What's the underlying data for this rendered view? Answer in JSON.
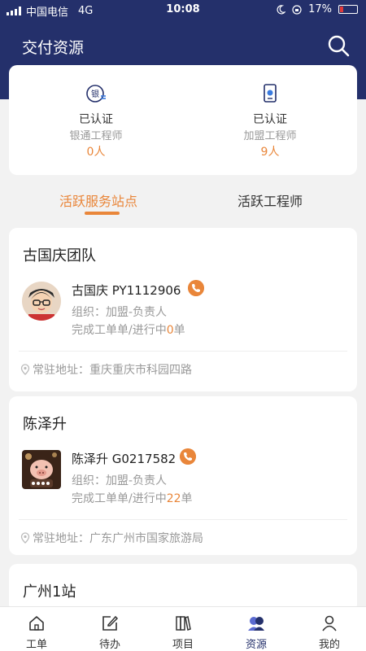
{
  "status_bar": {
    "carrier": "中国电信",
    "network": "4G",
    "time": "10:08",
    "battery": "17%"
  },
  "header": {
    "title": "交付资源",
    "search_icon": "search-icon"
  },
  "stats": [
    {
      "status": "已认证",
      "role": "银通工程师",
      "count": "0人",
      "icon": "bank-card-icon"
    },
    {
      "status": "已认证",
      "role": "加盟工程师",
      "count": "9人",
      "icon": "tablet-check-icon"
    }
  ],
  "tabs": {
    "active": "活跃服务站点",
    "inactive": "活跃工程师"
  },
  "cards": [
    {
      "team": "古国庆团队",
      "name": "古国庆 PY1112906",
      "org": "组织：加盟-负责人",
      "progress_prefix": "完成工单单/进行中",
      "progress_count": "0",
      "progress_suffix": "单",
      "address": "常驻地址：重庆重庆市科园四路",
      "avatar": "cartoon-man-avatar"
    },
    {
      "team": "陈泽升",
      "name": "陈泽升 G0217582",
      "org": "组织：加盟-负责人",
      "progress_prefix": "完成工单单/进行中",
      "progress_count": "22",
      "progress_suffix": "单",
      "address": "常驻地址：广东广州市国家旅游局",
      "avatar": "pig-photo-avatar"
    },
    {
      "team": "广州1站"
    }
  ],
  "tabbar": [
    {
      "label": "工单",
      "icon": "home-icon"
    },
    {
      "label": "待办",
      "icon": "edit-icon"
    },
    {
      "label": "项目",
      "icon": "books-icon"
    },
    {
      "label": "资源",
      "icon": "people-icon"
    },
    {
      "label": "我的",
      "icon": "person-icon"
    }
  ],
  "colors": {
    "header_bg": "#24306b",
    "accent": "#e9863a"
  }
}
